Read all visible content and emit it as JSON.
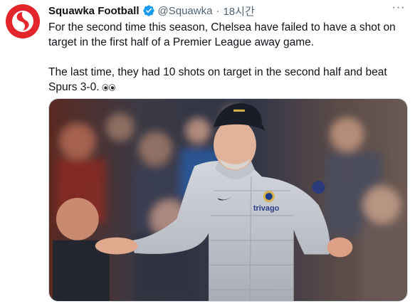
{
  "tweet": {
    "author": {
      "display_name": "Squawka Football",
      "handle": "@Squawka",
      "verified": true,
      "avatar_icon": "squawka-logo-icon",
      "avatar_color": "#e3262c"
    },
    "separator": "·",
    "timestamp": "18시간",
    "more_icon": "more-options-icon",
    "paragraphs": [
      "For the second time this season, Chelsea have failed to have a shot on target in the first half of a Premier League away game.",
      "The last time, they had 10 shots on target in the second half and beat Spurs 3-0."
    ],
    "emoji_icon": "eyes-icon",
    "media": {
      "type": "photo",
      "jacket_text": "trivago",
      "cap_color": "#1a1d27",
      "jacket_color": "#c9ccd2"
    }
  },
  "colors": {
    "verified_blue": "#1d9bf0",
    "text": "#0f1419",
    "muted": "#536471"
  }
}
